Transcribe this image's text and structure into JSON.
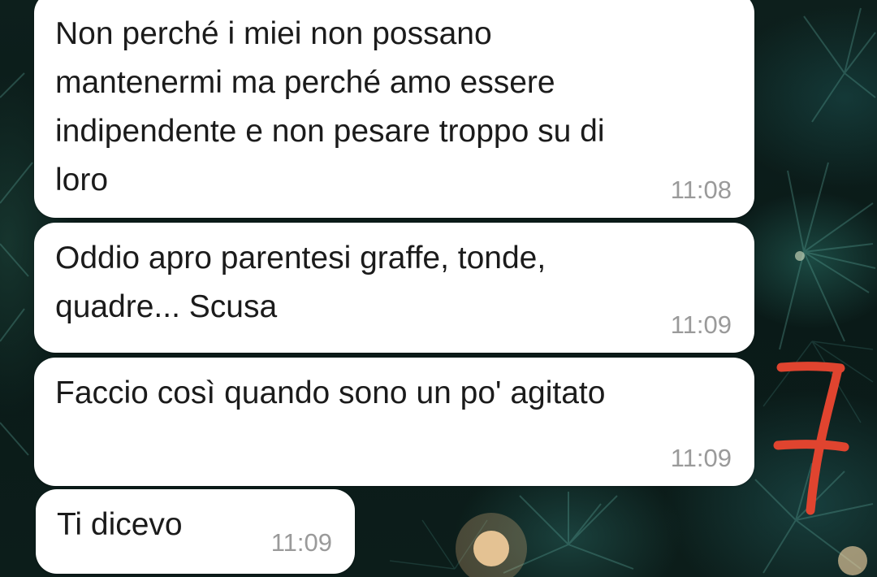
{
  "colors": {
    "bubble": "#ffffff",
    "text": "#1b1b1b",
    "timestamp": "#9a9a9a",
    "annotation": "#e0442f",
    "background": "#0d1f1c"
  },
  "messages": [
    {
      "text": "Non perché i miei non possano\nmantenermi ma perché amo essere\nindipendente e non pesare troppo su di\nloro",
      "time": "11:08"
    },
    {
      "text": "Oddio apro parentesi graffe, tonde,\nquadre... Scusa",
      "time": "11:09"
    },
    {
      "text": "Faccio così quando sono un po' agitato",
      "time": "11:09"
    },
    {
      "text": "Ti dicevo",
      "time": "11:09"
    }
  ],
  "annotation": {
    "text": "7",
    "icon": "handwritten-seven-mark"
  }
}
